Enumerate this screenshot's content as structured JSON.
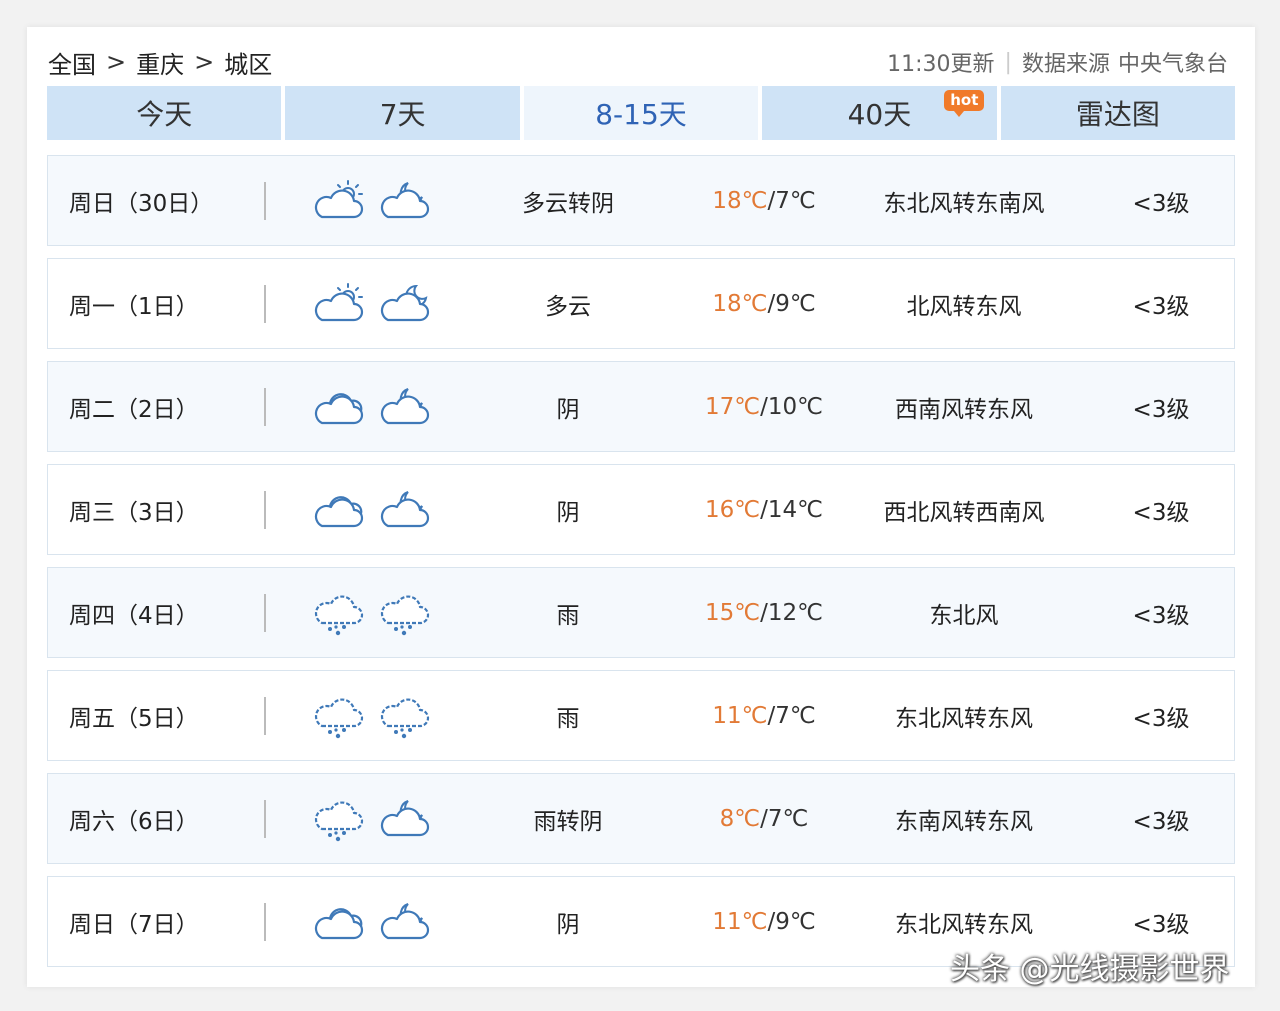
{
  "breadcrumb": [
    "全国",
    "重庆",
    "城区"
  ],
  "breadcrumb_separator": ">",
  "meta": {
    "updated": "11:30更新",
    "source_label": "数据来源",
    "source_value": "中央气象台"
  },
  "tabs": [
    {
      "label": "今天",
      "active": false,
      "badge": ""
    },
    {
      "label": "7天",
      "active": false,
      "badge": ""
    },
    {
      "label": "8-15天",
      "active": true,
      "badge": ""
    },
    {
      "label": "40天",
      "active": false,
      "badge": "hot"
    },
    {
      "label": "雷达图",
      "active": false,
      "badge": ""
    }
  ],
  "forecast": [
    {
      "day": "周日（30日）",
      "icon_day": "partly-cloudy-day-icon",
      "icon_night": "partly-cloudy-night-icon",
      "desc": "多云转阴",
      "high": "18℃",
      "low": "7℃",
      "wind": "东北风转东南风",
      "level": "<3级"
    },
    {
      "day": "周一（1日）",
      "icon_day": "partly-cloudy-day-icon",
      "icon_night": "moon-cloud-icon",
      "desc": "多云",
      "high": "18℃",
      "low": "9℃",
      "wind": "北风转东风",
      "level": "<3级"
    },
    {
      "day": "周二（2日）",
      "icon_day": "overcast-icon",
      "icon_night": "partly-cloudy-night-icon",
      "desc": "阴",
      "high": "17℃",
      "low": "10℃",
      "wind": "西南风转东风",
      "level": "<3级"
    },
    {
      "day": "周三（3日）",
      "icon_day": "overcast-icon",
      "icon_night": "partly-cloudy-night-icon",
      "desc": "阴",
      "high": "16℃",
      "low": "14℃",
      "wind": "西北风转西南风",
      "level": "<3级"
    },
    {
      "day": "周四（4日）",
      "icon_day": "rain-icon",
      "icon_night": "rain-icon",
      "desc": "雨",
      "high": "15℃",
      "low": "12℃",
      "wind": "东北风",
      "level": "<3级"
    },
    {
      "day": "周五（5日）",
      "icon_day": "rain-icon",
      "icon_night": "rain-icon",
      "desc": "雨",
      "high": "11℃",
      "low": "7℃",
      "wind": "东北风转东风",
      "level": "<3级"
    },
    {
      "day": "周六（6日）",
      "icon_day": "rain-icon",
      "icon_night": "partly-cloudy-night-icon",
      "desc": "雨转阴",
      "high": "8℃",
      "low": "7℃",
      "wind": "东南风转东风",
      "level": "<3级"
    },
    {
      "day": "周日（7日）",
      "icon_day": "overcast-icon",
      "icon_night": "partly-cloudy-night-icon",
      "desc": "阴",
      "high": "11℃",
      "low": "9℃",
      "wind": "东北风转东风",
      "level": "<3级"
    }
  ],
  "watermark": "头条 @光线摄影世界",
  "colors": {
    "tab_bg": "#cfe3f6",
    "tab_active_bg": "#eef5fc",
    "tab_active_text": "#2f63b5",
    "high_temp": "#e27a36",
    "icon_stroke": "#3f79b8",
    "hot_badge": "#f07a2a"
  }
}
